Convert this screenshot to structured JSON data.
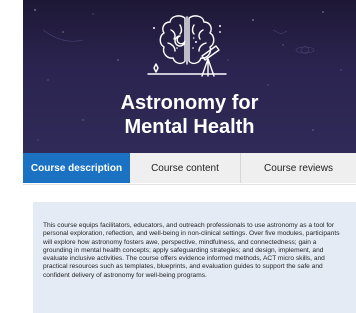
{
  "course": {
    "title_line1": "Astronomy for",
    "title_line2": "Mental Health"
  },
  "tabs": [
    {
      "label": "Course description",
      "active": true
    },
    {
      "label": "Course content",
      "active": false
    },
    {
      "label": "Course reviews",
      "active": false
    }
  ],
  "description": "This course equips facilitators, educators, and outreach professionals to use astronomy as a tool for personal exploration, reflection, and well-being in non-clinical settings. Over five modules, participants will explore how astronomy fosters awe, perspective, mindfulness, and connectedness; gain a grounding in mental health concepts; apply safeguarding strategies; and design, implement, and evaluate inclusive activities. The course offers evidence informed methods, ACT micro skills, and practical resources such as templates, blueprints, and evaluation guides to support the safe and confident delivery of astronomy for well-being programs.",
  "colors": {
    "hero_bg": "#2b2450",
    "tab_active": "#1b72c3",
    "tab_inactive": "#efefef",
    "desc_bg": "#e4ebf4"
  },
  "icons": {
    "hero": "brain-telescope-icon"
  }
}
